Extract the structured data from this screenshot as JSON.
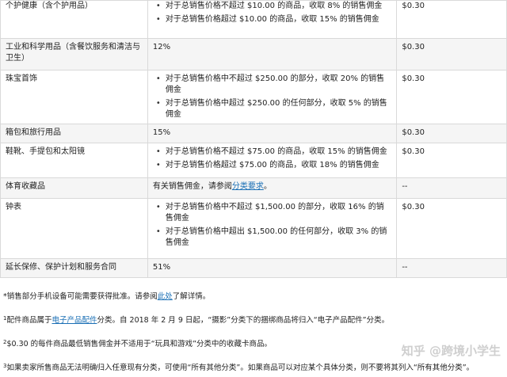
{
  "rows": [
    {
      "category": "个护健康（含个护用品）",
      "bullets": [
        "对于总销售价格不超过 $10.00 的商品，收取 8% 的销售佣金",
        "对于总销售价格超过 $10.00 的商品，收取 15% 的销售佣金"
      ],
      "fee": "$0.30"
    },
    {
      "category": "工业和科学用品（含餐饮服务和清洁与卫生）",
      "text": "12%",
      "fee": "$0.30"
    },
    {
      "category": "珠宝首饰",
      "bullets": [
        "对于总销售价格中不超过 $250.00 的部分，收取 20% 的销售佣金",
        "对于总销售价格中超过 $250.00 的任何部分，收取 5% 的销售佣金"
      ],
      "fee": "$0.30"
    },
    {
      "category": "箱包和旅行用品",
      "text": "15%",
      "fee": "$0.30"
    },
    {
      "category": "鞋靴、手提包和太阳镜",
      "bullets": [
        "对于总销售价格不超过 $75.00 的商品，收取 15% 的销售佣金",
        "对于总销售价格超过 $75.00 的商品，收取 18% 的销售佣金"
      ],
      "fee": "$0.30"
    },
    {
      "category": "体育收藏品",
      "text_prefix": "有关销售佣金，请参阅",
      "link": "分类要求",
      "text_suffix": "。",
      "fee": "--"
    },
    {
      "category": "钟表",
      "bullets": [
        "对于总销售价格中不超过 $1,500.00 的部分，收取 16% 的销售佣金",
        "对于总销售价格中超出 $1,500.00 的任何部分，收取 3% 的销售佣金"
      ],
      "fee": "$0.30"
    },
    {
      "category": "延长保修、保护计划和服务合同",
      "text": "51%",
      "fee": "--"
    }
  ],
  "footnotes": {
    "note0_prefix": "*销售部分手机设备可能需要获得批准。请参阅",
    "note0_link": "此处",
    "note0_suffix": "了解详情。",
    "note1_sup": "1",
    "note1_prefix": "配件商品属于",
    "note1_link": "电子产品配件",
    "note1_suffix": "分类。自 2018 年 2 月 9 日起，“摄影”分类下的捆绑商品将归入“电子产品配件”分类。",
    "note2_sup": "2",
    "note2_text": "$0.30 的每件商品最低销售佣金并不适用于“玩具和游戏”分类中的收藏卡商品。",
    "note3_sup": "3",
    "note3_text": "如果卖家所售商品无法明确归入任意现有分类，可使用“所有其他分类”。如果商品可以对应某个具体分类，则不要将其列入“所有其他分类”。"
  },
  "watermark": "知乎 @跨境小学生"
}
